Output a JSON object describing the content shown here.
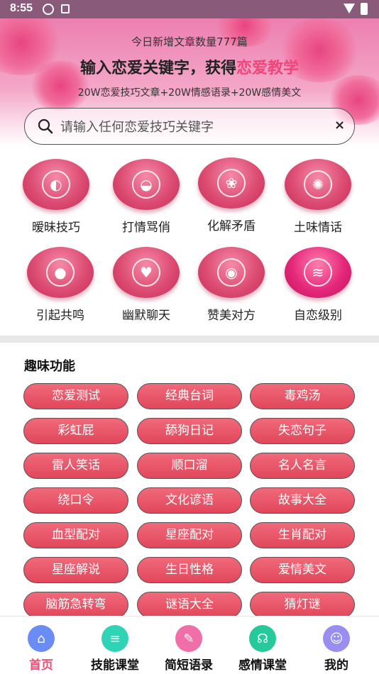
{
  "status_bar": {
    "time": "8:55"
  },
  "header": {
    "new_count": "今日新增文章数量777篇",
    "slogan_prefix": "输入恋爱关键字，获得",
    "slogan_highlight": "恋爱教学",
    "sub_slogan": "20W恋爱技巧文章+20W情感语录+20W感情美文"
  },
  "search": {
    "placeholder": "请输入任何恋爱技巧关键字",
    "clear_label": "×"
  },
  "categories": [
    {
      "label": "暧昧技巧",
      "icon": "lemon-slice-icon",
      "glyph": "◐"
    },
    {
      "label": "打情骂俏",
      "icon": "peach-icon",
      "glyph": "◒"
    },
    {
      "label": "化解矛盾",
      "icon": "cherry-icon",
      "glyph": "❀"
    },
    {
      "label": "土味情话",
      "icon": "orange-slice-icon",
      "glyph": "✺"
    },
    {
      "label": "引起共鸣",
      "icon": "tangerine-icon",
      "glyph": "●"
    },
    {
      "label": "幽默聊天",
      "icon": "strawberry-icon",
      "glyph": "♥"
    },
    {
      "label": "赞美对方",
      "icon": "lemon-icon",
      "glyph": "◉"
    },
    {
      "label": "自恋级别",
      "icon": "banana-icon",
      "glyph": "≋"
    }
  ],
  "fun_section": {
    "title": "趣味功能",
    "buttons": [
      "恋爱测试",
      "经典台词",
      "毒鸡汤",
      "彩虹屁",
      "舔狗日记",
      "失恋句子",
      "雷人笑话",
      "顺口溜",
      "名人名言",
      "绕口令",
      "文化谚语",
      "故事大全",
      "血型配对",
      "星座配对",
      "生肖配对",
      "星座解说",
      "生日性格",
      "爱情美文",
      "脑筋急转弯",
      "谜语大全",
      "猜灯谜"
    ]
  },
  "bottom_nav": [
    {
      "label": "首页",
      "icon": "home-icon",
      "color": "#6a8cf5",
      "glyph": "⌂"
    },
    {
      "label": "技能课堂",
      "icon": "database-icon",
      "color": "#2fd3b6",
      "glyph": "≡"
    },
    {
      "label": "简短语录",
      "icon": "pen-icon",
      "color": "#f06fa8",
      "glyph": "✎"
    },
    {
      "label": "感情课堂",
      "icon": "headset-icon",
      "color": "#25c99a",
      "glyph": "☊"
    },
    {
      "label": "我的",
      "icon": "user-icon",
      "color": "#9a8df0",
      "glyph": "☺"
    }
  ],
  "colors": {
    "accent": "#f0457a",
    "button": "#e2475b",
    "active_nav": "#ec4f75"
  }
}
